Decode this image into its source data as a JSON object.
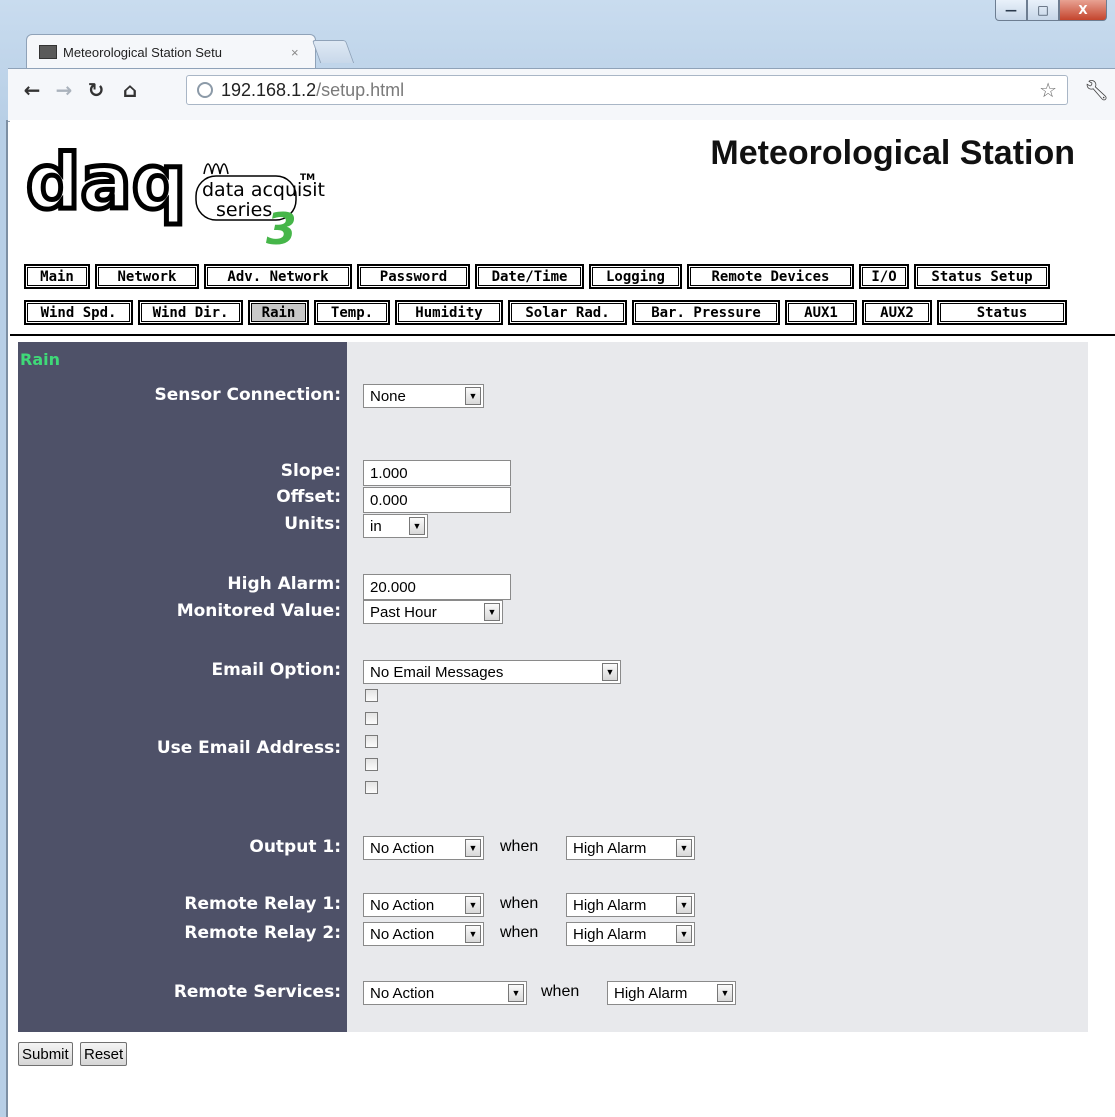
{
  "browser": {
    "tab_title": "Meteorological Station Setu",
    "tab_close": "×",
    "url_host": "192.168.1.2",
    "url_path": "/setup.html",
    "window_buttons": [
      "—",
      "□",
      "X"
    ]
  },
  "header": {
    "logo_text_daq": "daq",
    "logo_text_line1": "data acquisition",
    "logo_text_line2": "series",
    "logo_tm": "TM",
    "logo_num": "3",
    "title": "Meteorological Station"
  },
  "nav": {
    "row1": [
      "Main",
      "Network",
      "Adv. Network",
      "Password",
      "Date/Time",
      "Logging",
      "Remote Devices",
      "I/O",
      "Status Setup"
    ],
    "row2": [
      "Wind Spd.",
      "Wind Dir.",
      "Rain",
      "Temp.",
      "Humidity",
      "Solar Rad.",
      "Bar. Pressure",
      "AUX1",
      "AUX2",
      "Status"
    ],
    "active": "Rain"
  },
  "form": {
    "section_title": "Rain",
    "labels": {
      "sensor_connection": "Sensor Connection:",
      "slope": "Slope:",
      "offset": "Offset:",
      "units": "Units:",
      "high_alarm": "High Alarm:",
      "monitored_value": "Monitored Value:",
      "email_option": "Email Option:",
      "use_email_address": "Use Email Address:",
      "output1": "Output 1:",
      "remote_relay1": "Remote Relay 1:",
      "remote_relay2": "Remote Relay 2:",
      "remote_services": "Remote Services:"
    },
    "values": {
      "sensor_connection": "None",
      "slope": "1.000",
      "offset": "0.000",
      "units": "in",
      "high_alarm": "20.000",
      "monitored_value": "Past Hour",
      "email_option": "No Email Messages",
      "output1_action": "No Action",
      "output1_when": "High Alarm",
      "relay1_action": "No Action",
      "relay1_when": "High Alarm",
      "relay2_action": "No Action",
      "relay2_when": "High Alarm",
      "services_action": "No Action",
      "services_when": "High Alarm"
    },
    "email_checkboxes": [
      false,
      false,
      false,
      false,
      false
    ],
    "when_text": "when"
  },
  "buttons": {
    "submit": "Submit",
    "reset": "Reset"
  }
}
